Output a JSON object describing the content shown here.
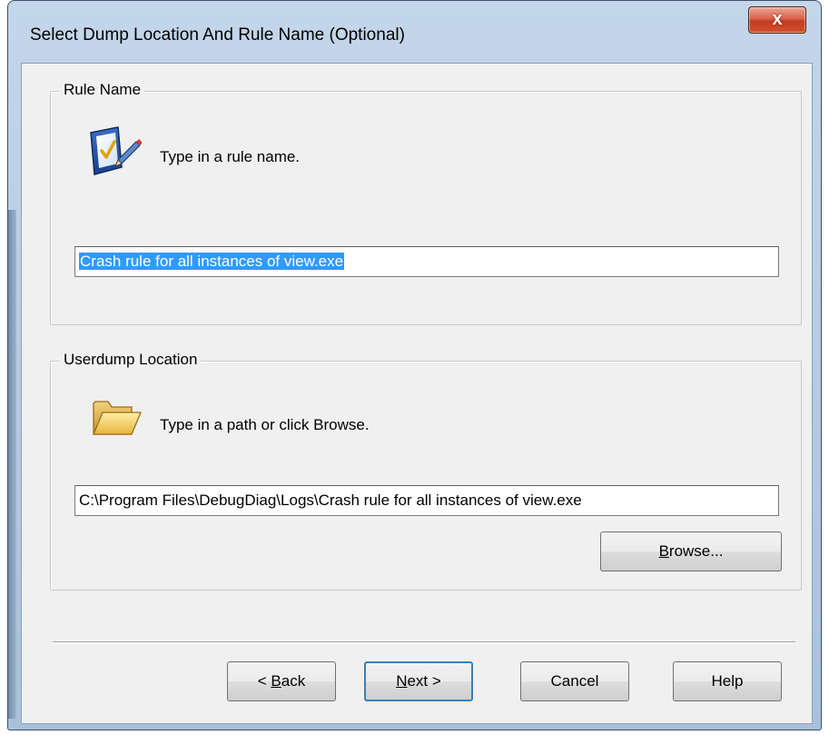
{
  "window": {
    "title": "Select Dump Location And Rule Name (Optional)",
    "close_glyph": "x"
  },
  "rule_group": {
    "legend": "Rule Name",
    "icon": "checklist-pen-icon",
    "instruction": "Type in a rule name.",
    "value": "Crash rule for all instances of view.exe",
    "value_selected": true
  },
  "location_group": {
    "legend": "Userdump Location",
    "icon": "folder-icon",
    "instruction": "Type in a path or click Browse.",
    "value": "C:\\Program Files\\DebugDiag\\Logs\\Crash rule for all instances of view.exe",
    "browse_label_mnemonic": "B",
    "browse_label_rest": "rowse..."
  },
  "buttons": {
    "back_prefix": "< ",
    "back_mnemonic": "B",
    "back_rest": "ack",
    "next_mnemonic": "N",
    "next_rest": "ext >",
    "cancel": "Cancel",
    "help": "Help"
  },
  "colors": {
    "selection": "#3399ff",
    "close_button": "#c8432a",
    "default_button_border": "#3c7fb1"
  }
}
